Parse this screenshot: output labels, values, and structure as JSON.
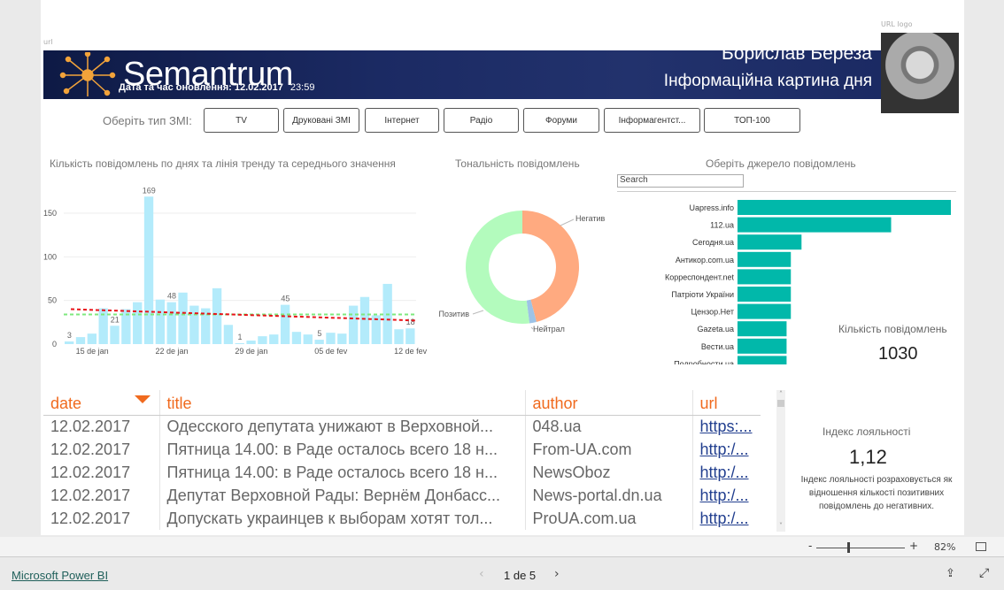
{
  "header": {
    "url_label": "url",
    "url_logo_label": "URL logo",
    "logo_text": "Semantrum",
    "update_label": "Дата та час оновлення: 12.02.2017",
    "update_time": "23:59",
    "person_name": "Борислав Береза",
    "subtitle": "Інформаційна картина дня"
  },
  "filter": {
    "label": "Оберіть тип ЗМІ:",
    "buttons": [
      "TV",
      "Друковані ЗМІ",
      "Інтернет",
      "Радіо",
      "Форуми",
      "Інформагентст...",
      "ТОП-100"
    ]
  },
  "chart_data": [
    {
      "type": "bar",
      "title": "Кількість повідомлень по днях та лінія тренду та середнього значення",
      "x": [
        "13 de jan",
        "14 de jan",
        "15 de jan",
        "16 de jan",
        "17 de jan",
        "18 de jan",
        "19 de jan",
        "20 de jan",
        "21 de jan",
        "22 de jan",
        "23 de jan",
        "24 de jan",
        "25 de jan",
        "26 de jan",
        "27 de jan",
        "28 de jan",
        "29 de jan",
        "30 de jan",
        "31 de jan",
        "01 de fev",
        "02 de fev",
        "03 de fev",
        "04 de fev",
        "05 de fev",
        "06 de fev",
        "07 de fev",
        "08 de fev",
        "09 de fev",
        "10 de fev",
        "11 de fev",
        "12 de fev"
      ],
      "values": [
        3,
        8,
        12,
        41,
        21,
        40,
        48,
        169,
        51,
        48,
        59,
        44,
        41,
        64,
        22,
        1,
        4,
        9,
        11,
        45,
        14,
        11,
        5,
        13,
        12,
        44,
        54,
        33,
        69,
        17,
        18
      ],
      "data_labels": [
        {
          "x": "13 de jan",
          "text": "3"
        },
        {
          "x": "17 de jan",
          "text": "21"
        },
        {
          "x": "20 de jan",
          "text": "169"
        },
        {
          "x": "22 de jan",
          "text": "48"
        },
        {
          "x": "28 de jan",
          "text": "1"
        },
        {
          "x": "01 de fev",
          "text": "45"
        },
        {
          "x": "04 de fev",
          "text": "5"
        },
        {
          "x": "12 de fev",
          "text": "18"
        }
      ],
      "x_ticks": [
        "15 de jan",
        "22 de jan",
        "29 de jan",
        "05 de fev",
        "12 de fev"
      ],
      "y_ticks": [
        0,
        50,
        100,
        150
      ],
      "ylim": [
        0,
        175
      ],
      "grid": true,
      "trend_line": {
        "start": 40,
        "end": 27,
        "color": "#e8141a"
      },
      "average_line": {
        "value": 34,
        "color": "#7ee87e"
      },
      "bar_color": "#b3ebfb"
    },
    {
      "type": "pie",
      "title": "Тональність повідомлень",
      "donut": true,
      "slices": [
        {
          "label": "Негатив",
          "value": 46,
          "color": "#ffaa80"
        },
        {
          "label": "Нейтрал",
          "value": 2,
          "color": "#9dc3e6"
        },
        {
          "label": "Позитив",
          "value": 52,
          "color": "#b3fbbd"
        }
      ]
    },
    {
      "type": "bar",
      "orientation": "horizontal",
      "title": "Оберіть джерело повідомлень",
      "categories": [
        "Uapress.info",
        "112.ua",
        "Сегодня.ua",
        "Антикор.com.ua",
        "Корреспондент.net",
        "Патріоти України",
        "Цензор.Нет",
        "Gazeta.ua",
        "Вести.ua",
        "Подробности.ua"
      ],
      "values": [
        100,
        72,
        30,
        25,
        25,
        25,
        25,
        23,
        23,
        23
      ],
      "bar_color": "#01b8aa"
    }
  ],
  "search": {
    "placeholder": "Search"
  },
  "count_card": {
    "label": "Кількість повідомлень",
    "value": "1030"
  },
  "table": {
    "columns": [
      "date",
      "title",
      "author",
      "url"
    ],
    "rows": [
      [
        "12.02.2017",
        "Одесского депутата унижают в Верховной...",
        "048.ua",
        "https:..."
      ],
      [
        "12.02.2017",
        "Пятница 14.00: в Раде осталось всего 18 н...",
        "From-UA.com",
        "http:/..."
      ],
      [
        "12.02.2017",
        "Пятница 14.00: в Раде осталось всего 18 н...",
        "NewsOboz",
        "http:/..."
      ],
      [
        "12.02.2017",
        "Депутат Верховной Рады: Вернём Донбасс...",
        "News-portal.dn.ua",
        "http:/..."
      ],
      [
        "12.02.2017",
        "Допускать украинцев к выборам хотят тол...",
        "ProUA.com.ua",
        "http:/..."
      ]
    ]
  },
  "loyalty": {
    "label": "Індекс лояльності",
    "value": "1,12",
    "description": "Індекс лояльності розраховується як відношення кількості позитивних повідомлень до негативних."
  },
  "zoom": {
    "minus": "-",
    "plus": "+",
    "level": "82%",
    "slider_fraction": 0.35
  },
  "footer": {
    "brand": "Microsoft Power BI",
    "page": "1 de 5"
  }
}
